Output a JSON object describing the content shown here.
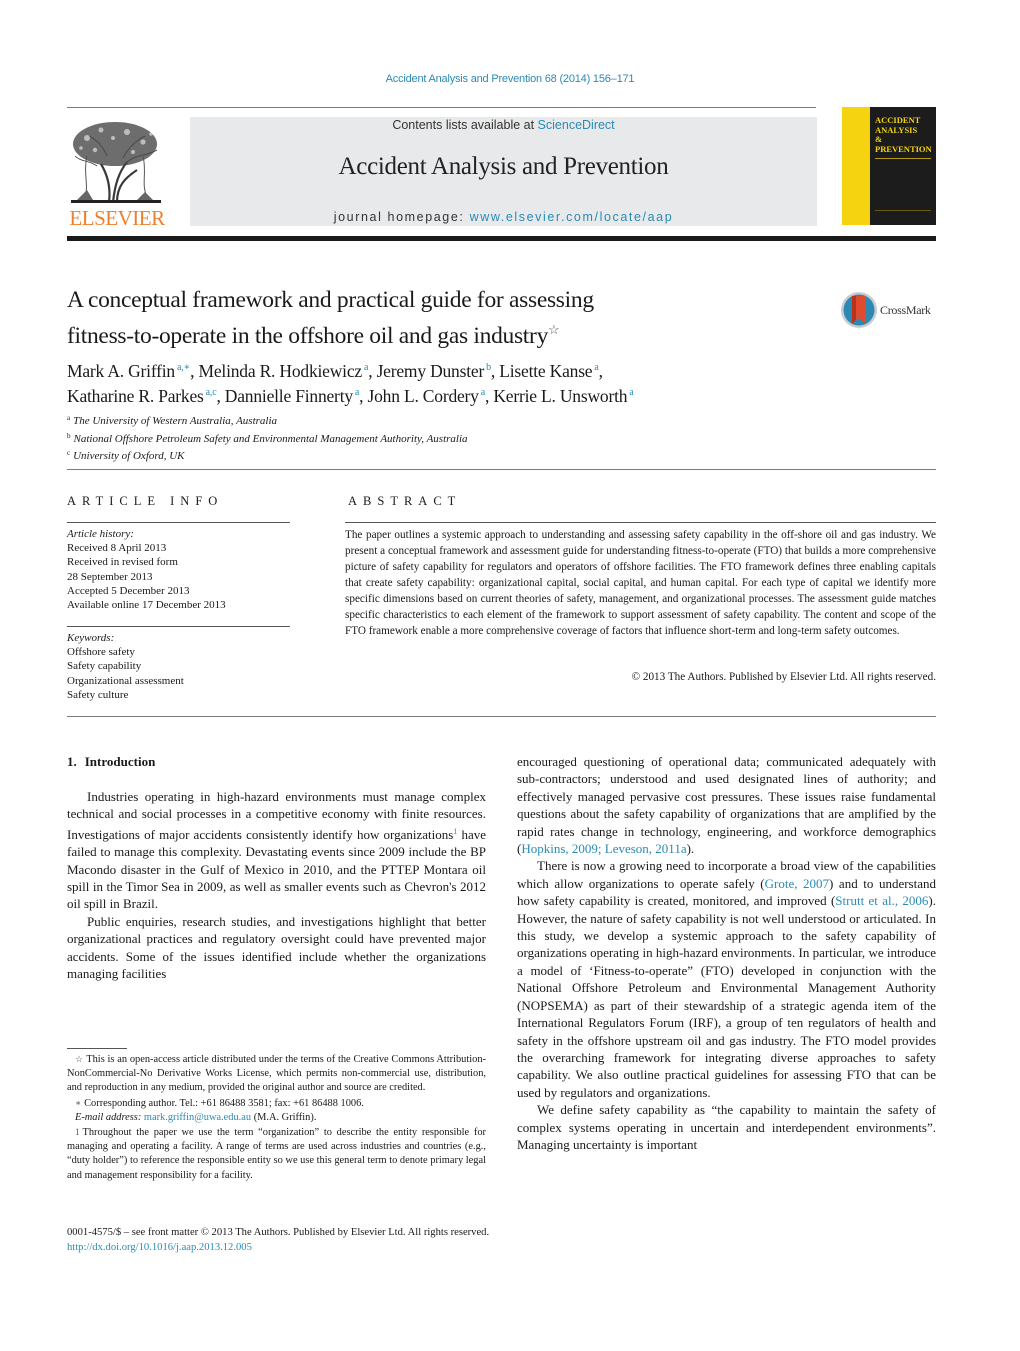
{
  "running_header": "Accident Analysis and Prevention 68 (2014) 156–171",
  "masthead": {
    "publisher_logo_text": "ELSEVIER",
    "contents_prefix": "Contents lists available at ",
    "contents_link": "ScienceDirect",
    "journal_title": "Accident Analysis and Prevention",
    "homepage_prefix": "journal homepage: ",
    "homepage_link": "www.elsevier.com/locate/aap",
    "cover_title_lines": [
      "ACCIDENT",
      "ANALYSIS",
      "&",
      "PREVENTION"
    ]
  },
  "colors": {
    "link": "#2a8bb5",
    "elsevier_orange": "#f07f2a",
    "cover_yellow": "#f5d311",
    "cover_dark": "#1c1c1c",
    "masthead_gray": "#e8e9ea"
  },
  "article": {
    "title_line1": "A conceptual framework and practical guide for assessing",
    "title_line2": "fitness-to-operate in the offshore oil and gas industry",
    "title_mark": "☆",
    "crossmark_label": "CrossMark",
    "authors_line1": [
      {
        "name": "Mark A. Griffin",
        "aff": "a,∗",
        "sep": ", "
      },
      {
        "name": "Melinda R. Hodkiewicz",
        "aff": "a",
        "sep": ", "
      },
      {
        "name": "Jeremy Dunster",
        "aff": "b",
        "sep": ", "
      },
      {
        "name": "Lisette Kanse",
        "aff": "a",
        "sep": ","
      }
    ],
    "authors_line2": [
      {
        "name": "Katharine R. Parkes",
        "aff": "a,c",
        "sep": ", "
      },
      {
        "name": "Dannielle Finnerty",
        "aff": "a",
        "sep": ", "
      },
      {
        "name": "John L. Cordery",
        "aff": "a",
        "sep": ", "
      },
      {
        "name": "Kerrie L. Unsworth",
        "aff": "a",
        "sep": ""
      }
    ],
    "affiliations": [
      {
        "key": "a",
        "text": "The University of Western Australia, Australia"
      },
      {
        "key": "b",
        "text": "National Offshore Petroleum Safety and Environmental Management Authority, Australia"
      },
      {
        "key": "c",
        "text": "University of Oxford, UK"
      }
    ]
  },
  "article_info": {
    "heading": "ARTICLE INFO",
    "history_label": "Article history:",
    "history": [
      "Received 8 April 2013",
      "Received in revised form",
      "28 September 2013",
      "Accepted 5 December 2013",
      "Available online 17 December 2013"
    ],
    "keywords_label": "Keywords:",
    "keywords": [
      "Offshore safety",
      "Safety capability",
      "Organizational assessment",
      "Safety culture"
    ]
  },
  "abstract": {
    "heading": "ABSTRACT",
    "text": "The paper outlines a systemic approach to understanding and assessing safety capability in the off-shore oil and gas industry. We present a conceptual framework and assessment guide for understanding fitness-to-operate (FTO) that builds a more comprehensive picture of safety capability for regulators and operators of offshore facilities. The FTO framework defines three enabling capitals that create safety capability: organizational capital, social capital, and human capital. For each type of capital we identify more specific dimensions based on current theories of safety, management, and organizational processes. The assessment guide matches specific characteristics to each element of the framework to support assessment of safety capability. The content and scope of the FTO framework enable a more comprehensive coverage of factors that influence short-term and long-term safety outcomes.",
    "copyright": "© 2013 The Authors. Published by Elsevier Ltd. All rights reserved."
  },
  "body": {
    "section_number": "1.",
    "section_title": "Introduction",
    "left_paragraphs": [
      {
        "parts": [
          {
            "t": "Industries operating in high-hazard environments must manage complex technical and social processes in a competitive economy with finite resources. Investigations of major accidents consistently identify how organizations"
          },
          {
            "sup": "1"
          },
          {
            "t": " have failed to manage this complexity. Devastating events since 2009 include the BP Macondo disaster in the Gulf of Mexico in 2010, and the PTTEP Montara oil spill in the Timor Sea in 2009, as well as smaller events such as Chevron's 2012 oil spill in Brazil."
          }
        ]
      },
      {
        "parts": [
          {
            "t": "Public enquiries, research studies, and investigations highlight that better organizational practices and regulatory oversight could have prevented major accidents. Some of the issues identified include whether the organizations managing facilities"
          }
        ]
      }
    ],
    "right_paragraphs": [
      {
        "noindent": true,
        "parts": [
          {
            "t": "encouraged questioning of operational data; communicated adequately with sub-contractors; understood and used designated lines of authority; and effectively managed pervasive cost pressures. These issues raise fundamental questions about the safety capability of organizations that are amplified by the rapid rates change in technology, engineering, and workforce demographics ("
          },
          {
            "link": "Hopkins, 2009; Leveson, 2011a"
          },
          {
            "t": ")."
          }
        ]
      },
      {
        "parts": [
          {
            "t": "There is now a growing need to incorporate a broad view of the capabilities which allow organizations to operate safely ("
          },
          {
            "link": "Grote, 2007"
          },
          {
            "t": ") and to understand how safety capability is created, monitored, and improved ("
          },
          {
            "link": "Strutt et al., 2006"
          },
          {
            "t": "). However, the nature of safety capability is not well understood or articulated. In this study, we develop a systemic approach to the safety capability of organizations operating in high-hazard environments. In particular, we introduce a model of ‘Fitness-to-operate” (FTO) developed in conjunction with the National Offshore Petroleum and Environmental Management Authority (NOPSEMA) as part of their stewardship of a strategic agenda item of the International Regulators Forum (IRF), a group of ten regulators of health and safety in the offshore upstream oil and gas industry. The FTO model provides the overarching framework for integrating diverse approaches to safety capability. We also outline practical guidelines for assessing FTO that can be used by regulators and organizations."
          }
        ]
      },
      {
        "parts": [
          {
            "t": "We define safety capability as “the capability to maintain the safety of complex systems operating in uncertain and interdependent environments”. Managing uncertainty is important"
          }
        ]
      }
    ]
  },
  "footnotes": {
    "star_mark": "☆",
    "star_text": "This is an open-access article distributed under the terms of the Creative Commons Attribution-NonCommercial-No Derivative Works License, which permits non-commercial use, distribution, and reproduction in any medium, provided the original author and source are credited.",
    "corr_mark": "∗",
    "corr_text": "Corresponding author. Tel.: +61 86488 3581; fax: +61 86488 1006.",
    "email_label": "E-mail address: ",
    "email": "mark.griffin@uwa.edu.au",
    "email_suffix": " (M.A. Griffin).",
    "fn1_mark": "1",
    "fn1_text": "Throughout the paper we use the term “organization” to describe the entity responsible for managing and operating a facility. A range of terms are used across industries and countries (e.g., “duty holder”) to reference the responsible entity so we use this general term to denote primary legal and management responsibility for a facility."
  },
  "front_matter": {
    "issn_line": "0001-4575/$ – see front matter © 2013 The Authors. Published by Elsevier Ltd. All rights reserved.",
    "doi": "http://dx.doi.org/10.1016/j.aap.2013.12.005"
  }
}
